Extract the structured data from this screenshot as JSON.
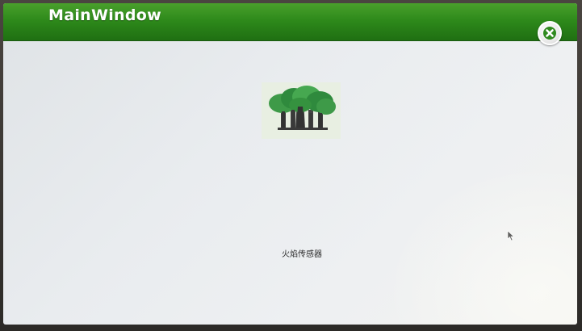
{
  "window": {
    "title": "MainWindow",
    "close_icon": "close-icon"
  },
  "main": {
    "image_icon": "forest-trees-icon",
    "sensor_label": "火焰传感器"
  },
  "colors": {
    "titlebar": "#2e8a1b",
    "content_background": "#e9ecef",
    "title_text": "#ffffff"
  }
}
